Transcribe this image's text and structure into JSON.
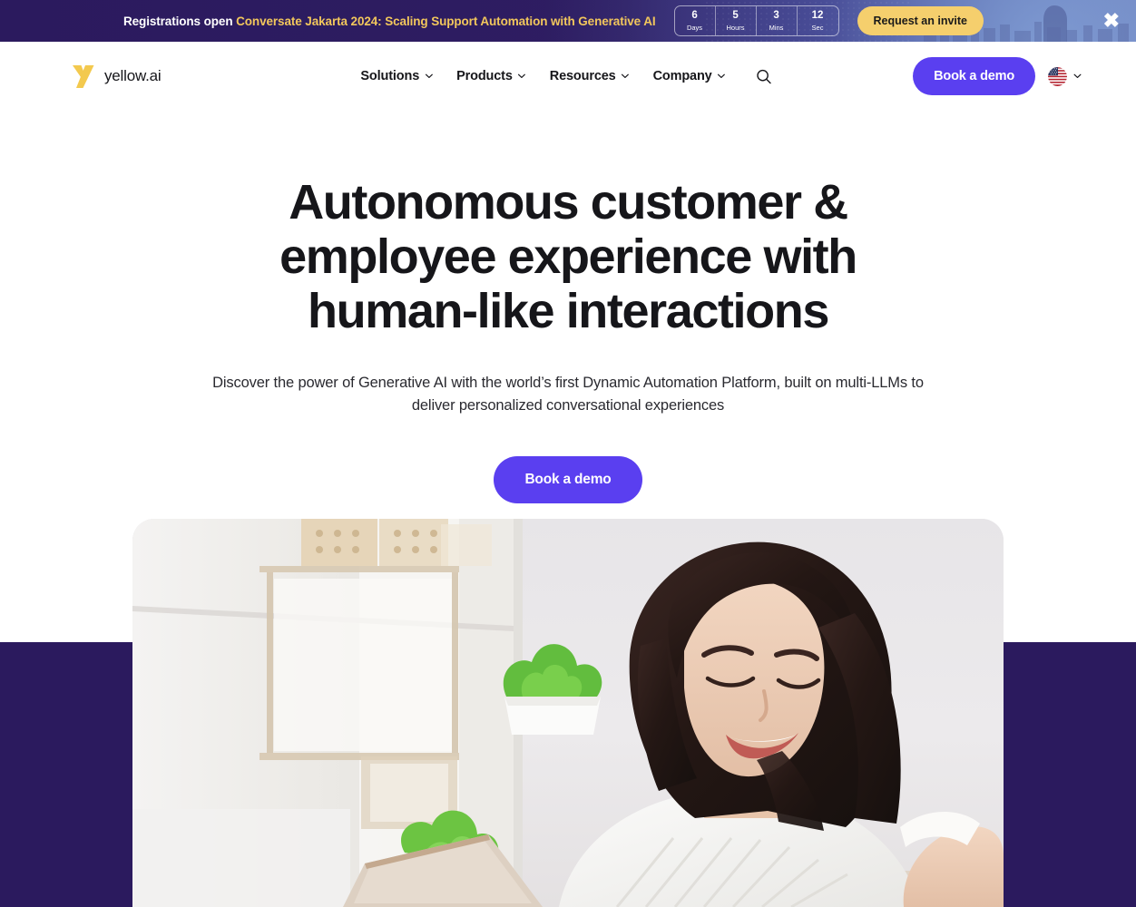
{
  "banner": {
    "lead_text": "Registrations open",
    "highlight_text": "Conversate Jakarta 2024: Scaling Support Automation with Generative AI",
    "countdown": [
      {
        "value": "6",
        "label": "Days"
      },
      {
        "value": "5",
        "label": "Hours"
      },
      {
        "value": "3",
        "label": "Mins"
      },
      {
        "value": "12",
        "label": "Sec"
      }
    ],
    "cta_label": "Request an invite",
    "close_label": "✖",
    "colors": {
      "background": "#2b1a5e",
      "highlight": "#f2c75c",
      "cta": "#f5cf6d"
    }
  },
  "header": {
    "logo_text": "yellow.ai",
    "nav": [
      {
        "label": "Solutions"
      },
      {
        "label": "Products"
      },
      {
        "label": "Resources"
      },
      {
        "label": "Company"
      }
    ],
    "search_icon": "search-icon",
    "demo_label": "Book a demo",
    "locale_icon": "us-flag-icon",
    "colors": {
      "accent": "#5a3ff0",
      "text": "#16161a"
    }
  },
  "hero": {
    "title_line1": "Autonomous customer &",
    "title_line2": "employee experience with",
    "title_line3": "human-like interactions",
    "subtitle": "Discover the power of Generative AI with the world’s first Dynamic Automation Platform, built on multi-LLMs to deliver personalized conversational experiences",
    "cta_label": "Book a demo",
    "media_alt": "woman-smiling-at-laptop-photo",
    "colors": {
      "band": "#2b1a5e",
      "cta": "#5a3ff0"
    }
  }
}
